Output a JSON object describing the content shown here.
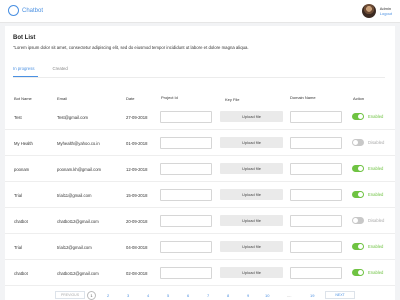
{
  "header": {
    "logo_text": "Chatbot",
    "user_name": "Admin",
    "logout_label": "Logout"
  },
  "page": {
    "title": "Bot List",
    "description": "\"Lorem ipsum dolor sit amet, consectetur adipiscing elit, sed do eiusmod tempor incididunt ut labore et dolore magna aliqua."
  },
  "tabs": [
    {
      "label": "In progress",
      "active": true
    },
    {
      "label": "Created",
      "active": false
    }
  ],
  "table": {
    "columns": [
      "Bot Name",
      "Email",
      "Date",
      "Project Id",
      "Key File",
      "Domain Name",
      "Action"
    ],
    "upload_label": "Upload file",
    "enabled_label": "Enabled",
    "disabled_label": "Disabled",
    "rows": [
      {
        "name": "Test",
        "email": "Test@gmail.com",
        "date": "27-09-2018",
        "project_id": "",
        "domain": "",
        "enabled": true
      },
      {
        "name": "My Health",
        "email": "Myhealth@yahoo.co.in",
        "date": "01-09-2018",
        "project_id": "",
        "domain": "",
        "enabled": false
      },
      {
        "name": "poonam",
        "email": "poonam.kh@gmail.com",
        "date": "12-09-2018",
        "project_id": "",
        "domain": "",
        "enabled": true
      },
      {
        "name": "Trial",
        "email": "trial11@gmail.com",
        "date": "15-09-2018",
        "project_id": "",
        "domain": "",
        "enabled": true
      },
      {
        "name": "chatbot",
        "email": "chatbot12@gmail.com",
        "date": "20-09-2018",
        "project_id": "",
        "domain": "",
        "enabled": false
      },
      {
        "name": "Trial",
        "email": "trial12@gmail.com",
        "date": "04-08-2018",
        "project_id": "",
        "domain": "",
        "enabled": true
      },
      {
        "name": "chatbot",
        "email": "chatbot12@gmail.com",
        "date": "02-08-2018",
        "project_id": "",
        "domain": "",
        "enabled": true
      }
    ]
  },
  "pagination": {
    "previous_label": "PREVIOUS",
    "next_label": "NEXT",
    "current": "1",
    "pages": [
      "2",
      "3",
      "4",
      "5",
      "6",
      "7",
      "8",
      "9",
      "10"
    ],
    "ellipsis": "....",
    "last": "19"
  },
  "colors": {
    "accent": "#4a90e2",
    "enabled": "#6fc342",
    "disabled": "#aaaaaa"
  }
}
